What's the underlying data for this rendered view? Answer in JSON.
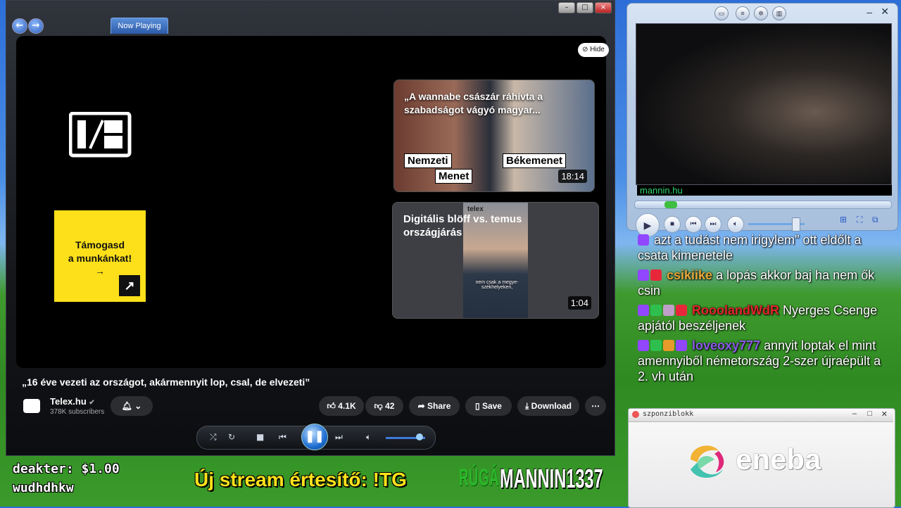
{
  "player": {
    "tab_label": "Now Playing",
    "hide_label": "Hide",
    "support_text_line1": "Támogasd",
    "support_text_line2": "a munkánkat!",
    "support_arrow": "→",
    "card1": {
      "title": "„A wannabe császár ráhívta a szabadságot vágyó magyar...",
      "tag_left_1": "Nemzeti",
      "tag_left_2": "Menet",
      "tag_right": "Békemenet",
      "duration": "18:14"
    },
    "card2": {
      "title": "Digitális blöff vs. temus országjárás",
      "watermark": "telex",
      "subtitle": "nem csak a megye-székhelyeken,",
      "duration": "1:04"
    },
    "video_title": "„16 éve vezeti az országot, akármennyit lop, csal, de elvezeti”",
    "channel_name": "Telex.hu",
    "channel_subs": "378K subscribers",
    "likes": "4.1K",
    "dislikes": "42",
    "share_label": "Share",
    "save_label": "Save",
    "download_label": "Download",
    "volume_level": 0.85
  },
  "cam": {
    "name": "mannin.hu",
    "seek_position": 0.12,
    "volume_level": 0.78
  },
  "chat": {
    "messages": [
      {
        "user": "",
        "text": "azt a tudást nem irigylem\" ott eldőlt a csata kimenetele"
      },
      {
        "user": "csikiike",
        "text": "a lopás akkor baj ha nem ők csin"
      },
      {
        "user": "RooolandWdR",
        "text": "Nyerges Csenge apjától beszéljenek"
      },
      {
        "user": "loveoxy777",
        "text": "annyit loptak el mint amennyiből németország 2-szer újraépült a 2. vh után"
      }
    ]
  },
  "sponsor": {
    "window_title": "szponziblokk",
    "brand": "eneba"
  },
  "banner": {
    "donation_name": "deakter: $1.00",
    "donation_message": "wudhdhkw",
    "notice": "Új stream értesítő: !TG",
    "label_1": "RÚGÁS",
    "label_2": "MANNIN1337"
  },
  "colors": {
    "accent": "#1f6fd2",
    "support_yellow": "#fde01a",
    "banner_yellow": "#ffe21a",
    "cam_name_green": "#2fd86f"
  }
}
